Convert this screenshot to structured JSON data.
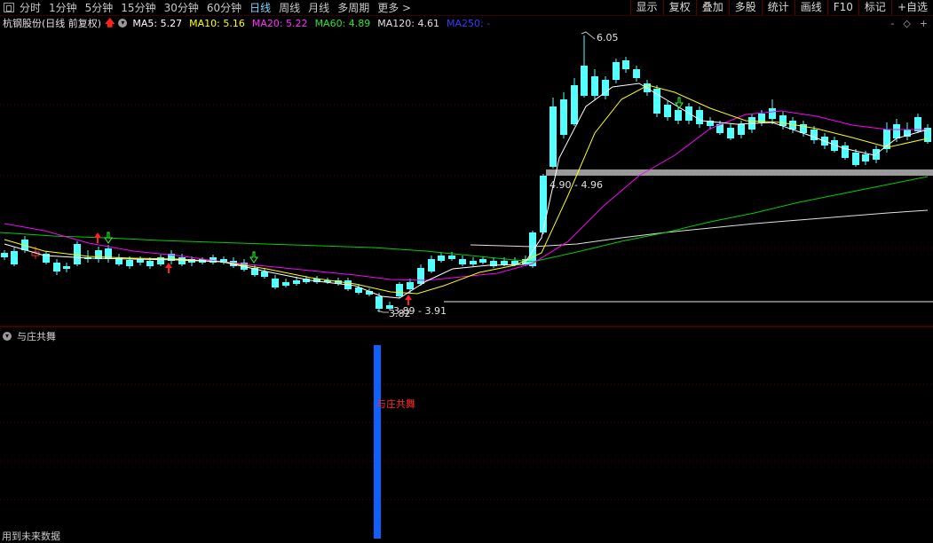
{
  "toolbar": {
    "timeframes": [
      "分时",
      "1分钟",
      "5分钟",
      "15分钟",
      "30分钟",
      "60分钟",
      "日线",
      "周线",
      "月线",
      "多周期",
      "更多 >"
    ],
    "active": "日线",
    "right_buttons": [
      "显示",
      "复权",
      "叠加",
      "多股",
      "统计",
      "画线",
      "F10",
      "标记",
      "+自选"
    ]
  },
  "info": {
    "stock": "杭钢股份(日线 前复权)",
    "ma": [
      {
        "label": "MA5: 5.27",
        "color": "#ffffff"
      },
      {
        "label": "MA10: 5.16",
        "color": "#ffff00"
      },
      {
        "label": "MA20: 5.22",
        "color": "#ff00ff"
      },
      {
        "label": "MA60: 4.89",
        "color": "#00e000"
      },
      {
        "label": "MA120: 4.61",
        "color": "#e0e0e0"
      },
      {
        "label": "MA250: -",
        "color": "#2020ff"
      }
    ],
    "icons": [
      "-",
      "◇",
      "+"
    ]
  },
  "annotations": {
    "high": "6.05",
    "band": "4.90 - 4.96",
    "low_range": "3.89 - 3.91",
    "low": "3.82"
  },
  "subchart": {
    "title": "与庄共舞",
    "signal_label": "与庄共舞",
    "signal_color": "#1060ff"
  },
  "footer": {
    "note": "用到未来数据"
  },
  "colors": {
    "up": "#ff3030",
    "down": "#54ffff",
    "grid": "#6a0000"
  }
}
